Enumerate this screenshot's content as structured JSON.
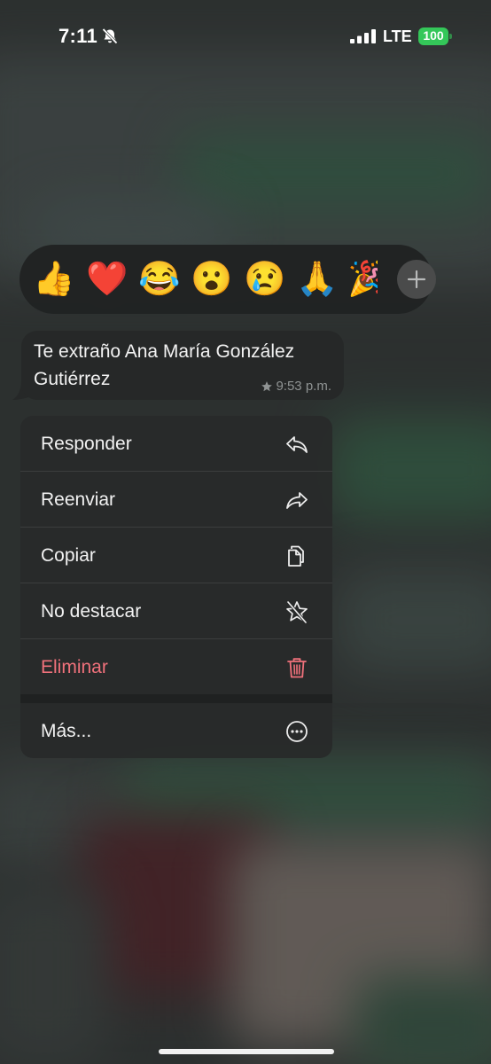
{
  "status_bar": {
    "time": "7:11",
    "network": "LTE",
    "battery": "100",
    "battery_color": "#34c759"
  },
  "reactions": {
    "emojis": [
      "👍",
      "❤️",
      "😂",
      "😮",
      "😢",
      "🙏",
      "🎉"
    ],
    "selected": "❤️",
    "more_icon": "plus-icon"
  },
  "message": {
    "text": "Te extraño Ana María González Gutiérrez",
    "time": "9:53 p.m.",
    "starred": true,
    "star_icon": "star-icon"
  },
  "menu": {
    "items": [
      {
        "label": "Responder",
        "icon": "reply-icon"
      },
      {
        "label": "Reenviar",
        "icon": "forward-icon"
      },
      {
        "label": "Copiar",
        "icon": "copy-icon"
      },
      {
        "label": "No destacar",
        "icon": "unstar-icon"
      },
      {
        "label": "Eliminar",
        "icon": "trash-icon",
        "color": "#f0717b"
      }
    ],
    "more": {
      "label": "Más...",
      "icon": "more-icon"
    }
  }
}
